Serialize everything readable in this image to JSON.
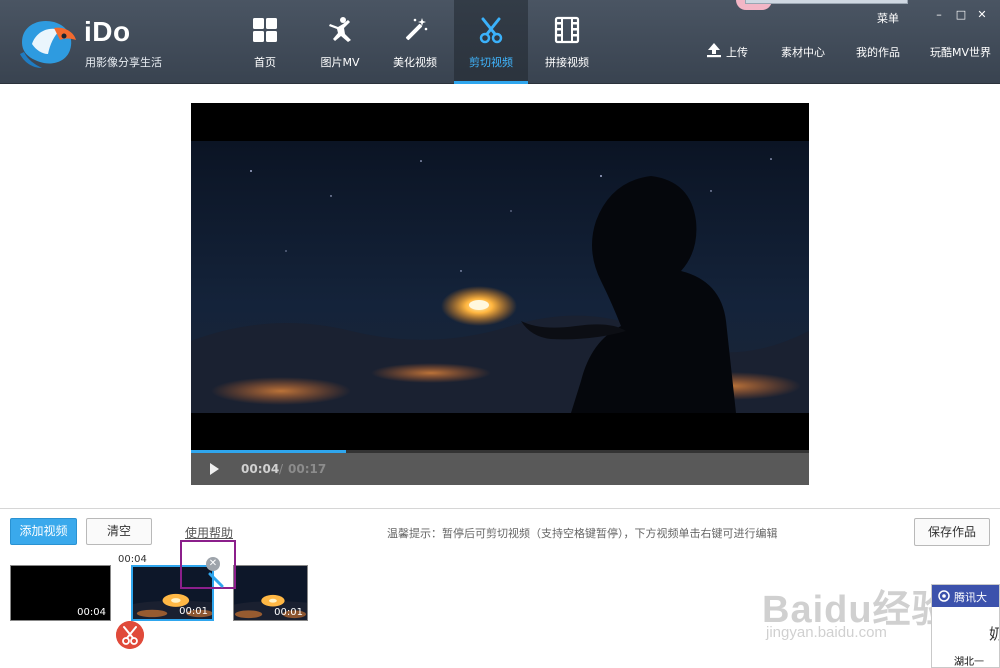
{
  "app": {
    "name": "iDo",
    "slogan": "用影像分享生活"
  },
  "nav": {
    "tabs": [
      {
        "label": "首页",
        "icon": "grid-icon"
      },
      {
        "label": "图片MV",
        "icon": "dancer-icon"
      },
      {
        "label": "美化视频",
        "icon": "magic-wand-icon"
      },
      {
        "label": "剪切视频",
        "icon": "scissors-icon",
        "active": true
      },
      {
        "label": "拼接视频",
        "icon": "film-strip-icon"
      }
    ]
  },
  "header_right": {
    "menu_label": "菜单",
    "minimize": "–",
    "maximize": "□",
    "close": "✕",
    "upload": "上传",
    "material_center": "素材中心",
    "my_works": "我的作品",
    "mv_world": "玩酷MV世界"
  },
  "player": {
    "current_time": "00:04",
    "separator": "/",
    "total_time": "00:17",
    "progress": 0.25
  },
  "toolbar": {
    "add_video": "添加视频",
    "clear": "清空",
    "help": "使用帮助",
    "tip": "温馨提示：暂停后可剪切视频（支持空格键暂停），下方视频单击右键可进行编辑",
    "save": "保存作品"
  },
  "timeline": {
    "cut_marker_time": "00:04",
    "clips": [
      {
        "duration": "00:04"
      },
      {
        "duration": "00:01",
        "selected": true
      },
      {
        "duration": "00:01"
      }
    ]
  },
  "watermark": {
    "main": "Baidu经验",
    "sub": "jingyan.baidu.com"
  },
  "popup": {
    "title": "腾讯大",
    "big": "奶",
    "line": "湖北一",
    "prefix": "湖北"
  },
  "colors": {
    "accent": "#2fa6ee",
    "topbar": "#3f4955",
    "player_controls": "#595959",
    "scissor_badge": "#e04a3a",
    "annotation_box": "#8b1f8b"
  }
}
